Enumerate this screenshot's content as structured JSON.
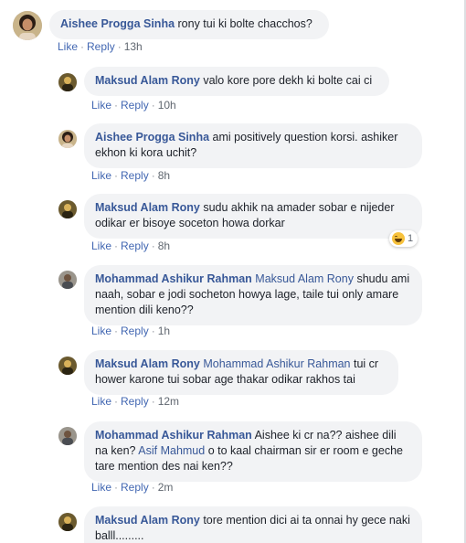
{
  "comments": [
    {
      "name": "Aishee Progga Sinha",
      "mention": "",
      "text": "rony tui ki bolte chacchos?",
      "like": "Like",
      "reply": "Reply",
      "time": "13h",
      "avatar": "female"
    },
    {
      "name": "Maksud Alam Rony",
      "mention": "",
      "text": "valo kore pore dekh ki bolte cai ci",
      "like": "Like",
      "reply": "Reply",
      "time": "10h",
      "avatar": "male-dark"
    },
    {
      "name": "Aishee Progga Sinha",
      "mention": "",
      "text": "ami positively question korsi. ashiker ekhon ki kora uchit?",
      "like": "Like",
      "reply": "Reply",
      "time": "8h",
      "avatar": "female"
    },
    {
      "name": "Maksud Alam Rony",
      "mention": "",
      "text": "sudu akhik na amader sobar e nijeder odikar er bisoye soceton howa dorkar",
      "like": "Like",
      "reply": "Reply",
      "time": "8h",
      "avatar": "male-dark",
      "reaction": {
        "icon": "haha-emoji-icon",
        "count": "1"
      }
    },
    {
      "name": "Mohammad Ashikur Rahman",
      "mention": "Maksud Alam Rony",
      "text": "shudu ami naah, sobar e jodi socheton howya lage, taile tui only amare mention dili keno??",
      "like": "Like",
      "reply": "Reply",
      "time": "1h",
      "avatar": "male-light"
    },
    {
      "name": "Maksud Alam Rony",
      "mention": "Mohammad Ashikur Rahman",
      "text": "tui cr hower karone tui sobar age thakar odikar rakhos tai",
      "like": "Like",
      "reply": "Reply",
      "time": "12m",
      "avatar": "male-dark"
    },
    {
      "name": "Mohammad Ashikur Rahman",
      "mention": "",
      "text_parts": [
        "Aishee ki cr na?? aishee dili na ken? ",
        "Asif Mahmud",
        " o to kaal chairman sir er room e geche tare mention des nai ken??"
      ],
      "like": "Like",
      "reply": "Reply",
      "time": "2m",
      "avatar": "male-light"
    },
    {
      "name": "Maksud Alam Rony",
      "mention": "",
      "text": "tore mention dici ai ta onnai hy gece naki balll.........",
      "avatar": "male-dark"
    }
  ]
}
